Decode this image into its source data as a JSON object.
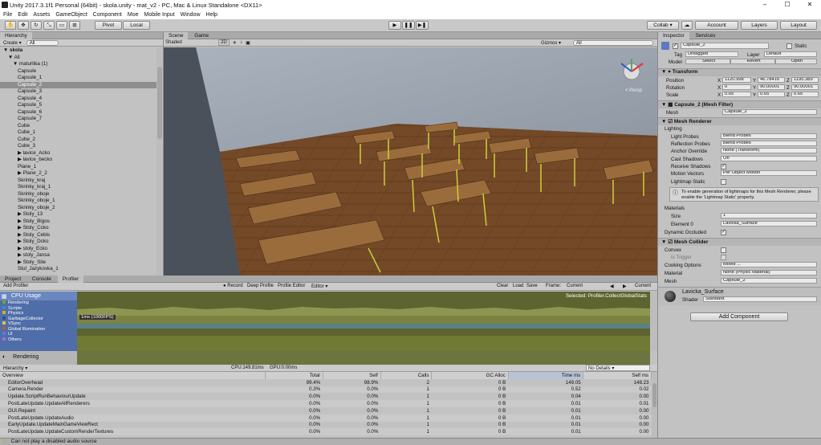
{
  "window": {
    "title": "Unity 2017.3.1f1 Personal (64bit) - skola.unity - mat_v2 - PC, Mac & Linux Standalone <DX11>",
    "min": "–",
    "max": "☐",
    "close": "✕"
  },
  "menu": [
    "File",
    "Edit",
    "Assets",
    "GameObject",
    "Component",
    "Moe",
    "Mobile Input",
    "Window",
    "Help"
  ],
  "toolbar": {
    "pivot": "Pivot",
    "local": "Local",
    "collab": "Collab ▾",
    "account": "Account",
    "layers": "Layers",
    "layout": "Layout"
  },
  "hierarchy": {
    "tab": "Hierarchy",
    "create": "Create ▾",
    "search": "All",
    "scene": "skola",
    "items": [
      {
        "t": "All",
        "i": 1
      },
      {
        "t": "maturitka (1)",
        "i": 2
      },
      {
        "t": "Capsule",
        "i": 3
      },
      {
        "t": "Capsule_1",
        "i": 3
      },
      {
        "t": "Capsule_2",
        "i": 3,
        "sel": true
      },
      {
        "t": "Capsule_3",
        "i": 3
      },
      {
        "t": "Capsule_4",
        "i": 3
      },
      {
        "t": "Capsule_5",
        "i": 3
      },
      {
        "t": "Capsule_6",
        "i": 3
      },
      {
        "t": "Capsule_7",
        "i": 3
      },
      {
        "t": "Cube",
        "i": 3
      },
      {
        "t": "Cube_1",
        "i": 3
      },
      {
        "t": "Cube_2",
        "i": 3
      },
      {
        "t": "Cube_3",
        "i": 3
      },
      {
        "t": "lavice_Acko",
        "i": 3,
        "arrow": true
      },
      {
        "t": "lavice_becko",
        "i": 3,
        "arrow": true
      },
      {
        "t": "Plane_1",
        "i": 3
      },
      {
        "t": "Plane_2_2",
        "i": 3,
        "arrow": true
      },
      {
        "t": "Skrinky_kraj",
        "i": 3
      },
      {
        "t": "Skrinky_kraj_1",
        "i": 3
      },
      {
        "t": "Skrinky_oboje",
        "i": 3
      },
      {
        "t": "Skrinky_oboje_1",
        "i": 3
      },
      {
        "t": "Skrinky_oboje_2",
        "i": 3
      },
      {
        "t": "Stoly_13",
        "i": 3,
        "arrow": true
      },
      {
        "t": "Stoly_Bigos",
        "i": 3,
        "arrow": true
      },
      {
        "t": "Stoly_Ccko",
        "i": 3,
        "arrow": true
      },
      {
        "t": "Stoly_Cebis",
        "i": 3,
        "arrow": true
      },
      {
        "t": "Stoly_Dcko",
        "i": 3,
        "arrow": true
      },
      {
        "t": "stoly_Ecko",
        "i": 3,
        "arrow": true
      },
      {
        "t": "stoly_Jansa",
        "i": 3,
        "arrow": true
      },
      {
        "t": "Stoly_Site",
        "i": 3,
        "arrow": true
      },
      {
        "t": "Stul_Jazykovka_1",
        "i": 3
      }
    ]
  },
  "scene": {
    "tabScene": "Scene",
    "tabGame": "Game",
    "shaded": "Shaded",
    "mode2d": "2D",
    "gizmos": "Gizmos ▾",
    "search": "All",
    "persp": "< Persp"
  },
  "inspector": {
    "tab": "Inspector",
    "tab2": "Services",
    "name": "Capsule_2",
    "static": "Static",
    "tag_label": "Tag",
    "tag": "Untagged",
    "layer_label": "Layer",
    "layer": "Default",
    "model_label": "Model",
    "select": "Select",
    "revert": "Revert",
    "open": "Open",
    "transform": {
      "title": "Transform",
      "position": "Position",
      "rotation": "Rotation",
      "scale": "Scale",
      "px": "1120.998",
      "py": "46.78416",
      "pz": "1195.389",
      "rx": "0",
      "ry": "90.00001",
      "rz": "90.00001",
      "sx": "0.65",
      "sy": "0.65",
      "sz": "0.65"
    },
    "filter": {
      "title": "Capsule_2 (Mesh Filter)",
      "mesh_label": "Mesh",
      "mesh": "Capsule_2"
    },
    "renderer": {
      "title": "Mesh Renderer",
      "lighting": "Lighting",
      "lightprobes_label": "Light Probes",
      "lightprobes": "Blend Probes",
      "refl_label": "Reflection Probes",
      "refl": "Blend Probes",
      "anchor_label": "Anchor Override",
      "anchor": "None (Transform)",
      "cast_label": "Cast Shadows",
      "cast": "On",
      "receive_label": "Receive Shadows",
      "motion_label": "Motion Vectors",
      "motion": "Per Object Motion",
      "lmstatic_label": "Lightmap Static",
      "info": "To enable generation of lightmaps for this Mesh Renderer, please enable the 'Lightmap Static' property.",
      "materials": "Materials",
      "size_label": "Size",
      "size": "1",
      "el0_label": "Element 0",
      "el0": "Lavicka_Surface",
      "dynocc_label": "Dynamic Occluded"
    },
    "collider": {
      "title": "Mesh Collider",
      "convex": "Convex",
      "trigger": "Is Trigger",
      "cooking_label": "Cooking Options",
      "cooking": "Mixed ...",
      "material_label": "Material",
      "material": "None (Physic Material)",
      "mesh_label": "Mesh",
      "mesh": "Capsule_2"
    },
    "material": {
      "name": "Lavicka_Surface",
      "shader_label": "Shader",
      "shader": "Standard"
    },
    "add": "Add Component"
  },
  "bottom": {
    "tabProject": "Project",
    "tabConsole": "Console",
    "tabProfiler": "Profiler",
    "addProfiler": "Add Profiler",
    "record": "Record",
    "deep": "Deep Profile",
    "editor": "Profile Editor",
    "editorSel": "Editor ▾",
    "clear": "Clear",
    "load": "Load",
    "save": "Save",
    "frame": "Frame:",
    "current": "Current",
    "currentBtn": "Current",
    "selected": "Selected: Profiler.CollectGlobalStats",
    "cpu": "CPU Usage",
    "fps": "1ms (1000FPS)",
    "legend": [
      "Rendering",
      "Scripts",
      "Physics",
      "GarbageCollector",
      "VSync",
      "Global Illumination",
      "UI",
      "Others"
    ],
    "legendColors": [
      "#6fa33e",
      "#3d8ec0",
      "#d7a93b",
      "#2f4f8f",
      "#d3c657",
      "#b65d3b",
      "#5a7bd6",
      "#9b6fd0"
    ],
    "renderingHdr": "Rendering",
    "hierarchy": "Hierarchy ▾",
    "cpuStat": "CPU:149.81ms",
    "gpuStat": "GPU:0.00ms",
    "nodetails": "No Details ▾"
  },
  "profTable": {
    "headers": [
      "Overview",
      "Total",
      "Self",
      "Calls",
      "GC Alloc",
      "Time ms",
      "Self ms"
    ],
    "rows": [
      [
        "EditorOverhead",
        "99.4%",
        "98.9%",
        "2",
        "0 B",
        "149.05",
        "148.23"
      ],
      [
        "Camera.Render",
        "0.3%",
        "0.0%",
        "1",
        "0 B",
        "0.52",
        "0.02"
      ],
      [
        "Update.ScriptRunBehaviourUpdate",
        "0.0%",
        "0.0%",
        "1",
        "0 B",
        "0.04",
        "0.00"
      ],
      [
        "PostLateUpdate.UpdateAllRenderers",
        "0.0%",
        "0.0%",
        "1",
        "0 B",
        "0.01",
        "0.01"
      ],
      [
        "GUI.Repaint",
        "0.0%",
        "0.0%",
        "1",
        "0 B",
        "0.01",
        "0.00"
      ],
      [
        "PostLateUpdate.UpdateAudio",
        "0.0%",
        "0.0%",
        "1",
        "0 B",
        "0.01",
        "0.00"
      ],
      [
        "EarlyUpdate.UpdateMainGameViewRect",
        "0.0%",
        "0.0%",
        "1",
        "0 B",
        "0.01",
        "0.00"
      ],
      [
        "PostLateUpdate.UpdateCustomRenderTextures",
        "0.0%",
        "0.0%",
        "1",
        "0 B",
        "0.01",
        "0.00"
      ]
    ]
  },
  "status": "Can not play a disabled audio source"
}
